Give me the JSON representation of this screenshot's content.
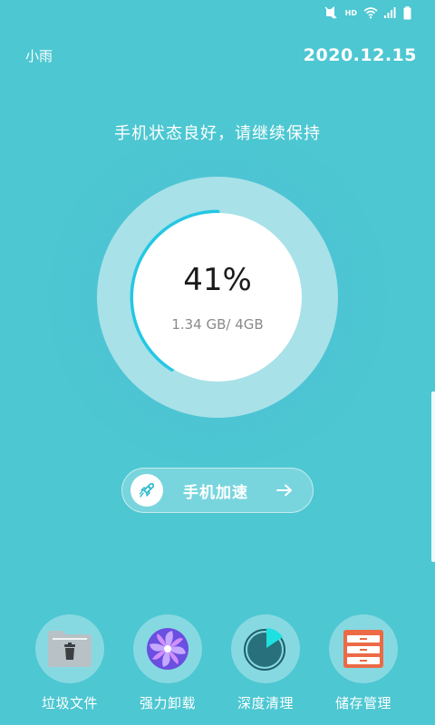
{
  "status_bar": {
    "icons": [
      "mute-vibrate-icon",
      "hd-icon",
      "wifi-icon",
      "signal-icon",
      "battery-icon"
    ],
    "hd_label": "HD"
  },
  "header": {
    "user_name": "小雨",
    "date": "2020.12.15"
  },
  "status_message": "手机状态良好，请继续保持",
  "memory": {
    "percent_label": "41%",
    "usage_label": "1.34 GB/ 4GB",
    "used_fraction": 0.41,
    "ring_color": "#24c7e3"
  },
  "boost_button": {
    "label": "手机加速",
    "icon": "rocket-icon",
    "arrow": "arrow-right-icon"
  },
  "tools": [
    {
      "label": "垃圾文件",
      "icon": "trash-folder-icon",
      "color": "#b7c1c6"
    },
    {
      "label": "强力卸载",
      "icon": "pinwheel-icon",
      "color": "#7a5ee8"
    },
    {
      "label": "深度清理",
      "icon": "pie-clean-icon",
      "color": "#27707c"
    },
    {
      "label": "储存管理",
      "icon": "storage-cabinet-icon",
      "color": "#ec6a45"
    }
  ],
  "colors": {
    "background": "#4dc7d2",
    "gauge_outer": "#a8e1e8",
    "accent": "#24c7e3"
  }
}
